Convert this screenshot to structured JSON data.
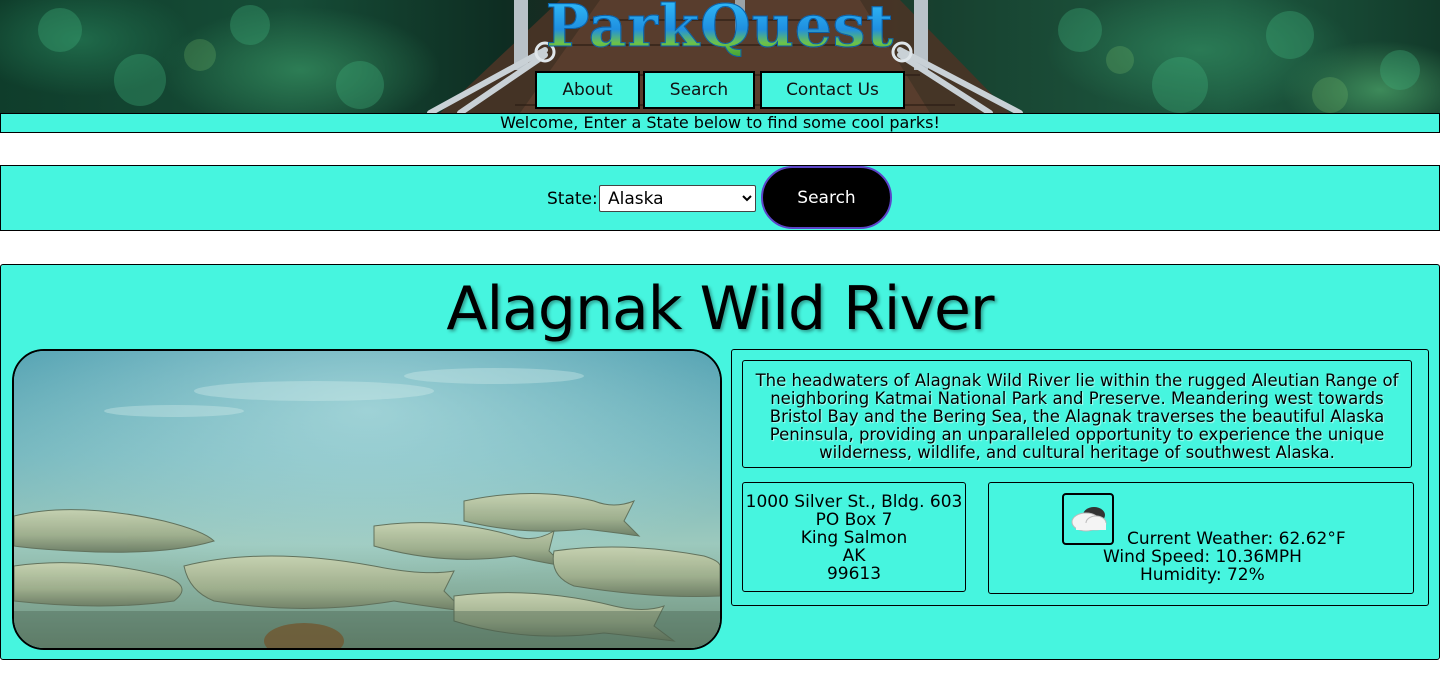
{
  "header": {
    "logo_text": "ParkQuest",
    "nav": [
      {
        "label": "About"
      },
      {
        "label": "Search"
      },
      {
        "label": "Contact Us"
      }
    ],
    "welcome": "Welcome, Enter a State below to find some cool parks!"
  },
  "search": {
    "state_label": "State:",
    "selected_state": "Alaska",
    "button_label": "Search",
    "button_color": "#000000"
  },
  "park": {
    "name": "Alagnak Wild River",
    "description": "The headwaters of Alagnak Wild River lie within the rugged Aleutian Range of neighboring Katmai National Park and Preserve. Meandering west towards Bristol Bay and the Bering Sea, the Alagnak traverses the beautiful Alaska Peninsula, providing an unparalleled opportunity to experience the unique wilderness, wildlife, and cultural heritage of southwest Alaska.",
    "address": {
      "line1": "1000 Silver St., Bldg. 603",
      "line2": "PO Box 7",
      "city": "King Salmon",
      "state": "AK",
      "zip": "99613"
    },
    "weather": {
      "icon": "partly-cloudy-icon",
      "current": "Current Weather: 62.62°F",
      "wind": "Wind Speed: 10.36MPH",
      "humidity": "Humidity: 72%"
    }
  },
  "theme": {
    "accent": "#46f5df",
    "logo_blue": "#1f8fe0",
    "logo_green": "#3b9b2f"
  }
}
